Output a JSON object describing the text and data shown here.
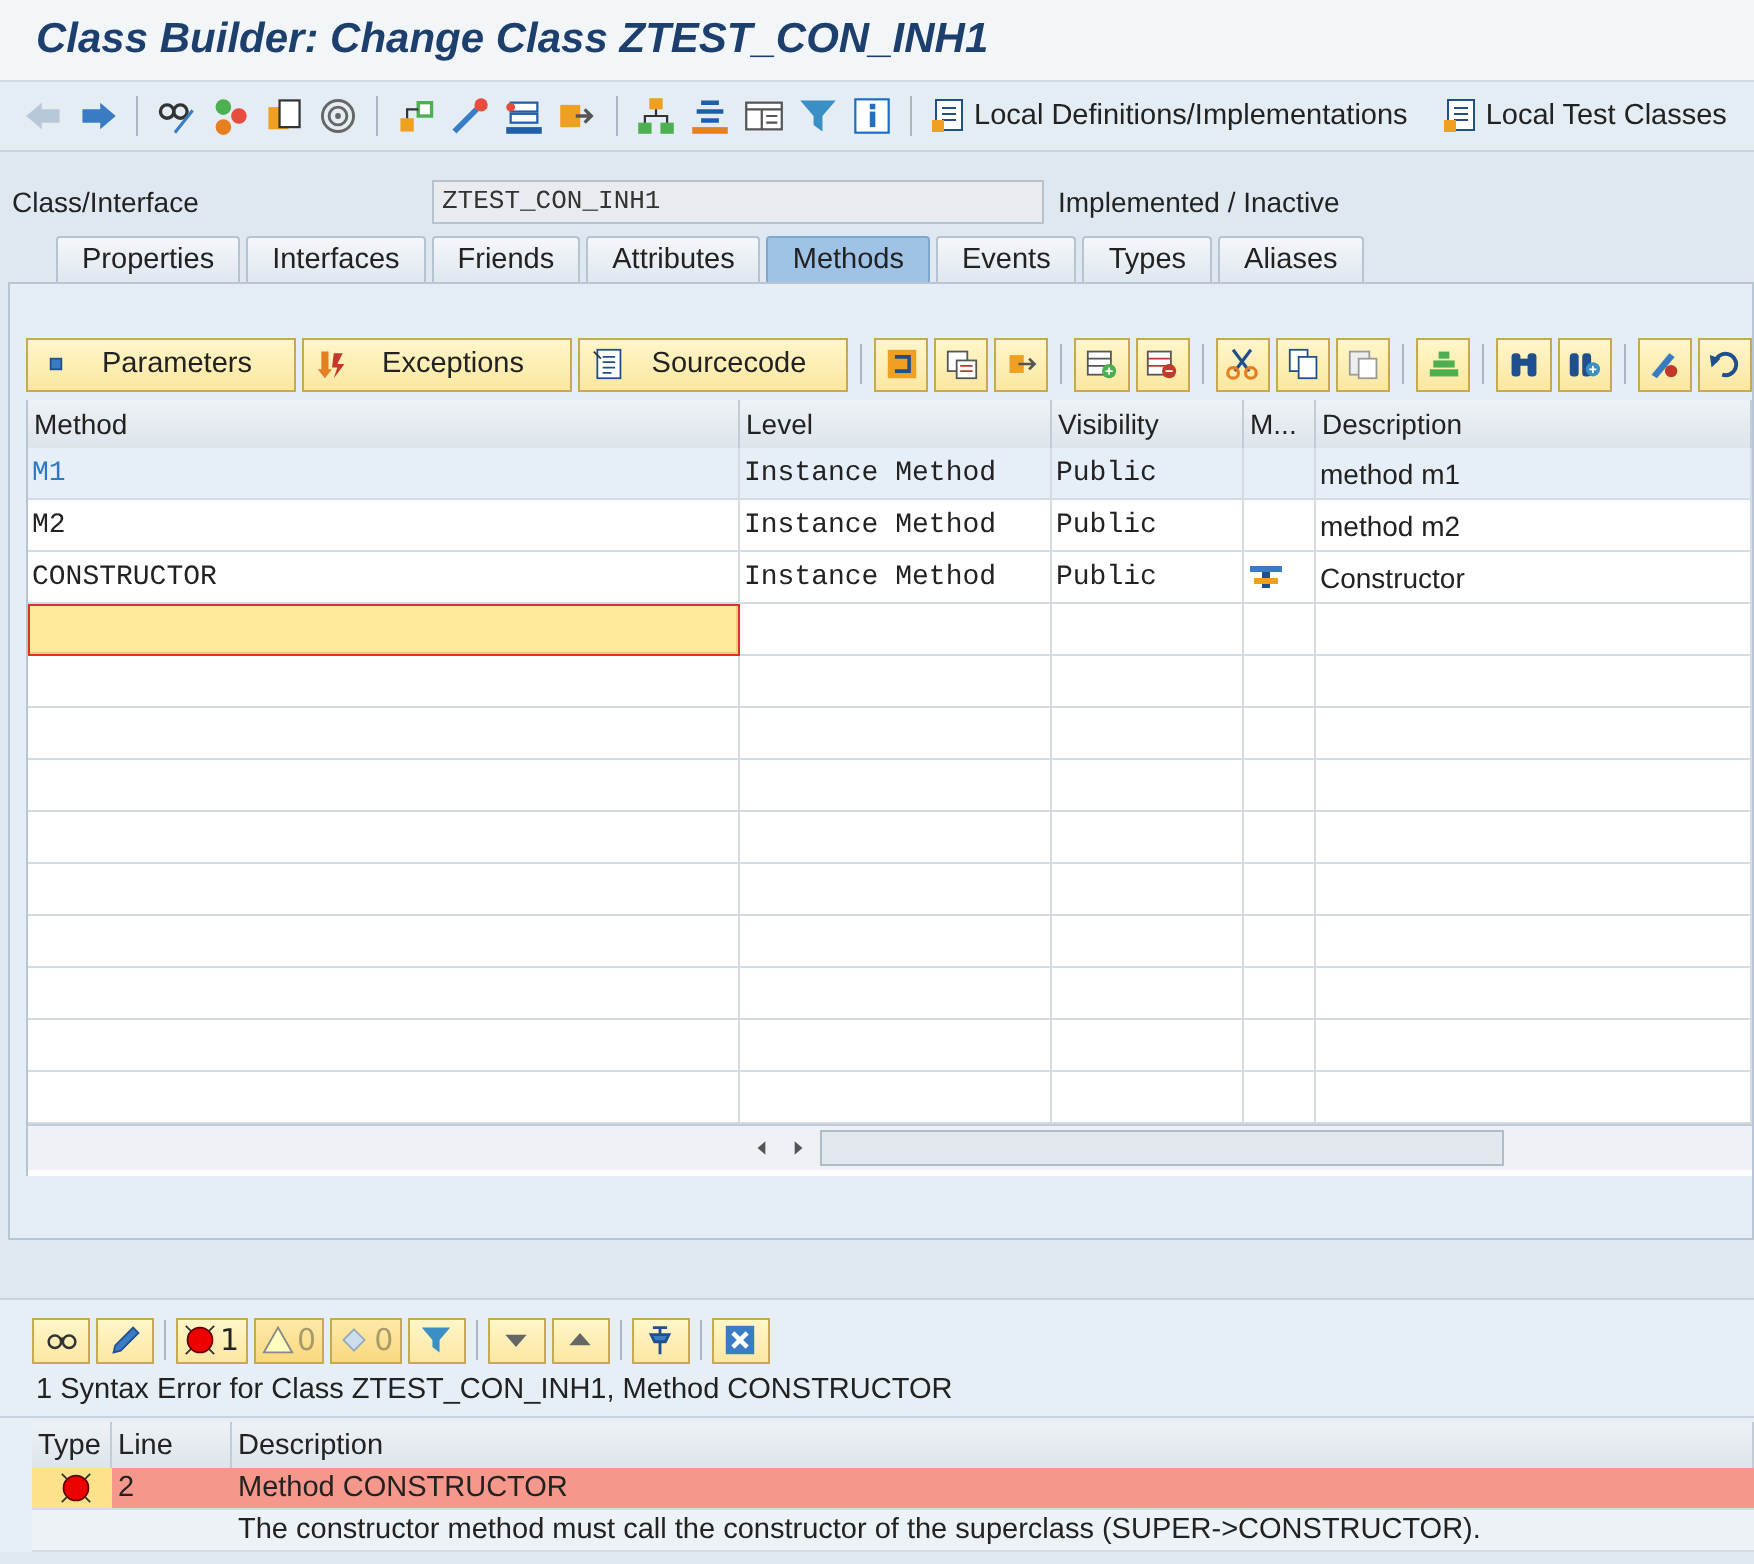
{
  "window": {
    "title": "Class Builder: Change Class ZTEST_CON_INH1"
  },
  "toolbar": {
    "buttons": [
      {
        "label": "Local Definitions/Implementations"
      },
      {
        "label": "Local Test Classes"
      }
    ]
  },
  "header": {
    "label": "Class/Interface",
    "value": "ZTEST_CON_INH1",
    "status": "Implemented / Inactive"
  },
  "tabs": [
    {
      "label": "Properties",
      "selected": false
    },
    {
      "label": "Interfaces",
      "selected": false
    },
    {
      "label": "Friends",
      "selected": false
    },
    {
      "label": "Attributes",
      "selected": false
    },
    {
      "label": "Methods",
      "selected": true
    },
    {
      "label": "Events",
      "selected": false
    },
    {
      "label": "Types",
      "selected": false
    },
    {
      "label": "Aliases",
      "selected": false
    }
  ],
  "method_toolbar": {
    "buttons": [
      {
        "label": "Parameters"
      },
      {
        "label": "Exceptions"
      },
      {
        "label": "Sourcecode"
      }
    ]
  },
  "table": {
    "columns": [
      "Method",
      "Level",
      "Visibility",
      "M...",
      "Description"
    ],
    "rows": [
      {
        "method": "M1",
        "level": "Instance Method",
        "visibility": "Public",
        "has_marker": false,
        "description": "method m1",
        "selected": true
      },
      {
        "method": "M2",
        "level": "Instance Method",
        "visibility": "Public",
        "has_marker": false,
        "description": "method m2",
        "selected": false
      },
      {
        "method": "CONSTRUCTOR",
        "level": "Instance Method",
        "visibility": "Public",
        "has_marker": true,
        "description": "Constructor",
        "selected": false
      }
    ],
    "input_row": {
      "focused": true
    }
  },
  "messages": {
    "counts": {
      "errors": "1",
      "warnings": "0",
      "infos": "0"
    },
    "summary": "1 Syntax Error for Class ZTEST_CON_INH1, Method CONSTRUCTOR",
    "columns": [
      "Type",
      "Line",
      "Description"
    ],
    "rows": [
      {
        "kind": "error",
        "line": "2",
        "description": "Method CONSTRUCTOR",
        "detail": "The constructor method must call the constructor of the superclass (SUPER->CONSTRUCTOR)."
      }
    ]
  }
}
